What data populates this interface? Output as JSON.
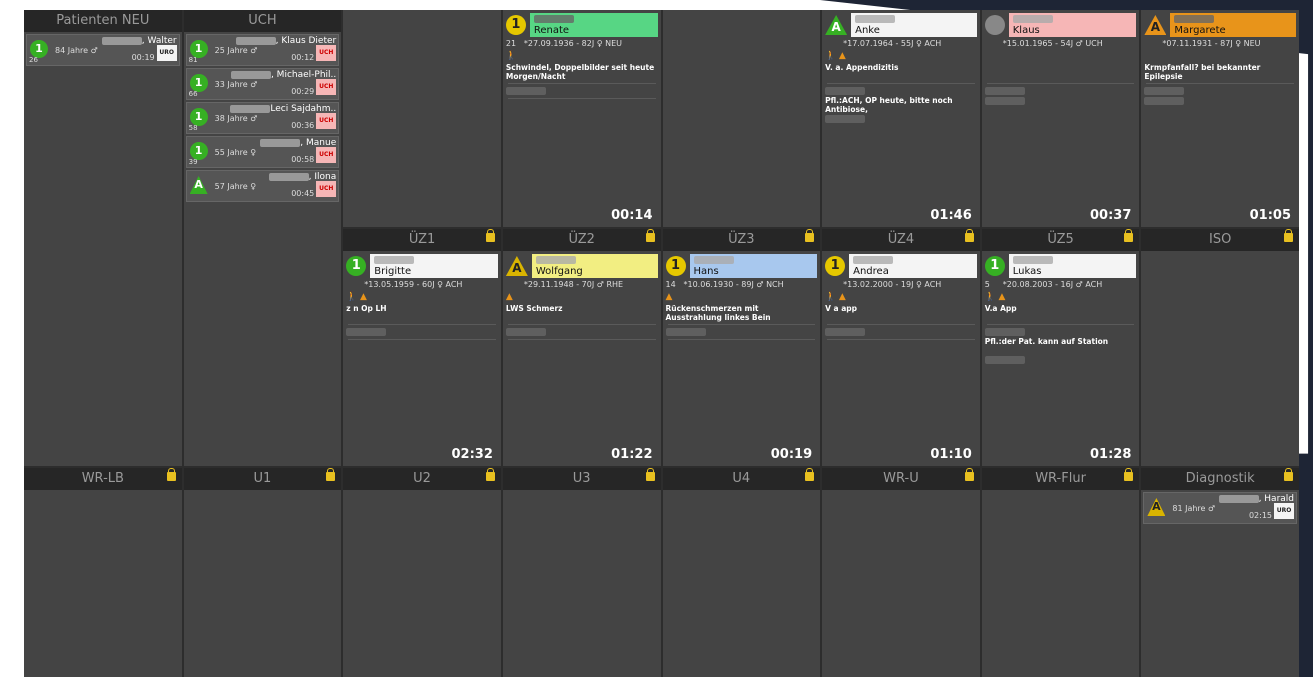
{
  "colors": {
    "green": "#36b023",
    "yellow": "#e6c800",
    "orange": "#e8941a",
    "lock": "#e8c020",
    "bg": "#444444"
  },
  "top_row": [
    {
      "header": "Patienten NEU",
      "minis": [
        {
          "name": ", Walter",
          "age": "84 Jahre ♂",
          "num": "26",
          "time": "00:19",
          "badge": "URO",
          "level": "1"
        }
      ]
    },
    {
      "header": ""
    },
    {
      "header": "",
      "card": {
        "level": "1",
        "name": "Renate",
        "dob": "*27.09.1936 - 82J ♀ NEU",
        "num": "21",
        "diag": "Schwindel, Doppelbilder seit heute Morgen/Nacht",
        "time": "00:14"
      }
    },
    {
      "header": ""
    },
    {
      "header": "",
      "card": {
        "level": "A",
        "name": "Anke",
        "dob": "*17.07.1964 - 55J ♀ ACH",
        "num": "",
        "diag": "V. a. Appendizitis",
        "note": "Pfl.:ACH, OP heute, bitte noch Antibiose,",
        "time": "01:46"
      }
    },
    {
      "header": "",
      "card": {
        "level": "",
        "name": "Klaus",
        "dob": "*15.01.1965 - 54J ♂ UCH",
        "num": "",
        "diag": "",
        "time": "00:37"
      }
    },
    {
      "header": "",
      "card": {
        "level": "A",
        "name": "Margarete",
        "dob": "*07.11.1931 - 87J ♀ NEU",
        "num": "",
        "diag": "Krmpfanfall? bei bekannter Epilepsie",
        "time": "01:05"
      }
    },
    {
      "header": "UCH",
      "minis": [
        {
          "name": ", Klaus Dieter",
          "age": "25 Jahre ♂",
          "num": "81",
          "time": "00:12",
          "badge": "UCH",
          "level": "1"
        },
        {
          "name": ", Michael-Phil..",
          "age": "33 Jahre ♂",
          "num": "66",
          "time": "00:29",
          "badge": "UCH",
          "level": "1"
        },
        {
          "name": "Leci Sajdahm..",
          "age": "38 Jahre ♂",
          "num": "58",
          "time": "00:36",
          "badge": "UCH",
          "level": "1"
        },
        {
          "name": ", Manue",
          "age": "55 Jahre ♀",
          "num": "39",
          "time": "00:58",
          "badge": "UCH",
          "level": "1"
        },
        {
          "name": ", Ilona",
          "age": "57 Jahre ♀",
          "num": "",
          "time": "00:45",
          "badge": "UCH",
          "level": "A"
        }
      ]
    }
  ],
  "mid_row": [
    {
      "header": ""
    },
    {
      "header": "ÜZ1",
      "card": {
        "level": "1",
        "name": "Brigitte",
        "dob": "*13.05.1959 - 60J ♀ ACH",
        "num": "",
        "diag": "z n Op LH",
        "time": "02:32"
      }
    },
    {
      "header": "ÜZ2",
      "card": {
        "level": "A",
        "name": "Wolfgang",
        "dob": "*29.11.1948 - 70J ♂ RHE",
        "num": "",
        "diag": "LWS Schmerz",
        "time": "01:22"
      }
    },
    {
      "header": "ÜZ3",
      "card": {
        "level": "1",
        "name": "Hans",
        "dob": "*10.06.1930 - 89J ♂ NCH",
        "num": "14",
        "diag": "Rückenschmerzen mit Ausstrahlung linkes Bein",
        "time": "00:19"
      }
    },
    {
      "header": "ÜZ4",
      "card": {
        "level": "1",
        "name": "Andrea",
        "dob": "*13.02.2000 - 19J ♀ ACH",
        "num": "",
        "diag": "V a app",
        "time": "01:10"
      }
    },
    {
      "header": "ÜZ5",
      "card": {
        "level": "1",
        "name": "Lukas",
        "dob": "*20.08.2003 - 16J ♂ ACH",
        "num": "5",
        "diag": "V.a App",
        "note": "Pfl.:der Pat. kann auf Station",
        "time": "01:28"
      }
    },
    {
      "header": "ISO"
    },
    {
      "header": ""
    }
  ],
  "bot_row": [
    {
      "header": "WR-LB"
    },
    {
      "header": "U1"
    },
    {
      "header": "U2"
    },
    {
      "header": "U3"
    },
    {
      "header": "U4"
    },
    {
      "header": "WR-U"
    },
    {
      "header": "WR-Flur"
    },
    {
      "header": "Diagnostik",
      "minis": [
        {
          "name": ", Harald",
          "age": "81 Jahre ♂",
          "num": "",
          "time": "02:15",
          "badge": "URO",
          "level": "A"
        }
      ]
    }
  ]
}
